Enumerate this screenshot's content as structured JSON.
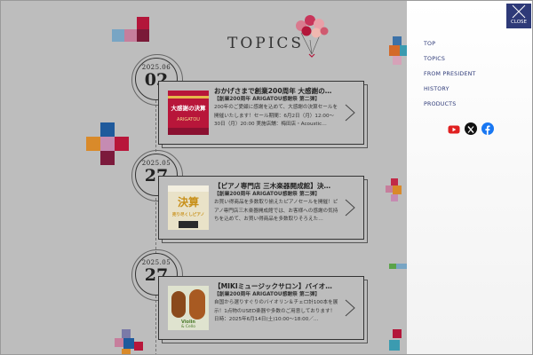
{
  "topics": {
    "heading": "TOPICS",
    "posts": [
      {
        "date_ym": "2025.06",
        "date_d": "02",
        "title": "おかげさまで創業200周年 大感謝の…",
        "sub": "【創業200周年 ARIGATOU感謝祭 第二弾】",
        "body": "200年のご愛顧に感謝を込めて、大感謝の決算セールを開催いたします！セール期間：6月2日（月）12:00〜30日（月）20:00 実施店舗：梅田店・Acoustic…",
        "thumb_text": "大感謝の決算",
        "thumb_caption": "ARIGATOU"
      },
      {
        "date_ym": "2025.05",
        "date_d": "27",
        "title": "【ピアノ専門店 三木楽器開成館】決…",
        "sub": "【創業200周年 ARIGATOU感謝祭 第二弾】",
        "body": "お買い得商品を多数取り揃えたピアノセールを開催！ピアノ専門店三木楽器開成館では、お客様への感謝の気持ちを込めて、お買い得商品を多数取りそろえた…",
        "thumb_text": "決算",
        "thumb_caption": "売り尽くしピアノ"
      },
      {
        "date_ym": "2025.05",
        "date_d": "27",
        "title": "【MIKIミュージックサロン】バイオ…",
        "sub": "【創業200周年 ARIGATOU感謝祭 第二弾】",
        "body": "自国から選りすぐりのバイオリン＆チェロ計100本を展示！1点物のUSED楽器や多数のご用意しております！日時：2025年6月14日(土)10:00〜18:00／…",
        "thumb_text": "Violin",
        "thumb_caption": "& Cello"
      }
    ]
  },
  "side_menu": {
    "close_label": "CLOSE",
    "items": [
      "TOP",
      "TOPICS",
      "FROM PRESIDENT",
      "HISTORY",
      "PRODUCTS"
    ],
    "social": [
      "youtube-icon",
      "x-icon",
      "facebook-icon"
    ],
    "accent": "#2e3a78"
  }
}
